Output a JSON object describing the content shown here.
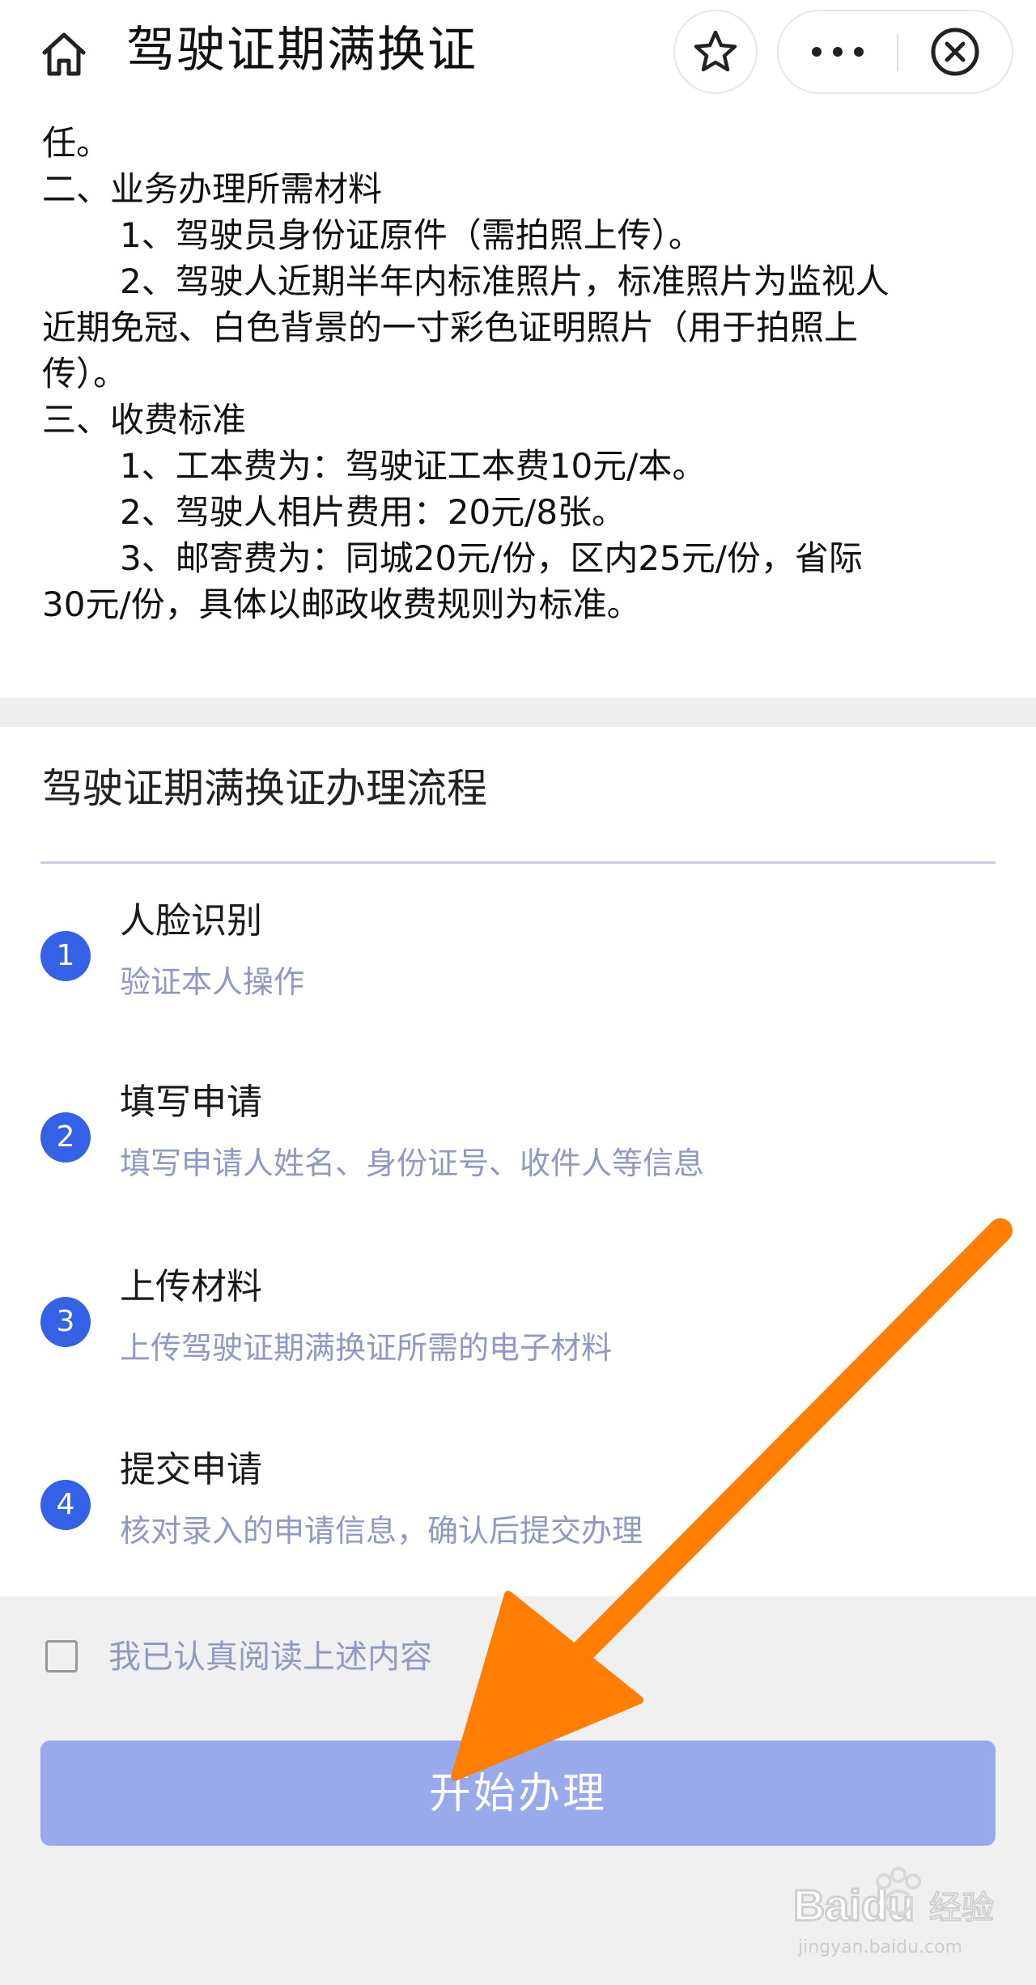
{
  "navbar": {
    "title": "驾驶证期满换证",
    "home_icon": "home-icon",
    "star_icon": "star-icon",
    "more_icon": "more-dots-icon",
    "close_icon": "close-circle-icon"
  },
  "notice": {
    "tail": "任。",
    "section2_title": "二、业务办理所需材料",
    "section2_item1": "1、驾驶员身份证原件（需拍照上传）。",
    "section2_item2_line1": "2、驾驶人近期半年内标准照片，标准照片为监视人",
    "section2_item2_line2": "近期免冠、白色背景的一寸彩色证明照片（用于拍照上",
    "section2_item2_line3": "传）。",
    "section3_title": "三、收费标准",
    "section3_item1": "1、工本费为：驾驶证工本费10元/本。",
    "section3_item2": "2、驾驶人相片费用：20元/8张。",
    "section3_item3_line1": "3、邮寄费为：同城20元/份，区内25元/份，省际",
    "section3_item3_line2": "30元/份，具体以邮政收费规则为标准。"
  },
  "process": {
    "title": "驾驶证期满换证办理流程",
    "steps": [
      {
        "num": "1",
        "title": "人脸识别",
        "desc": "验证本人操作"
      },
      {
        "num": "2",
        "title": "填写申请",
        "desc": "填写申请人姓名、身份证号、收件人等信息"
      },
      {
        "num": "3",
        "title": "上传材料",
        "desc": "上传驾驶证期满换证所需的电子材料"
      },
      {
        "num": "4",
        "title": "提交申请",
        "desc": "核对录入的申请信息，确认后提交办理"
      }
    ]
  },
  "agreement": {
    "label": "我已认真阅读上述内容",
    "checked": false
  },
  "start_button": {
    "label": "开始办理"
  },
  "watermark": {
    "brand": "Baidu",
    "brand_cn": "经验",
    "url": "jingyan.baidu.com"
  },
  "colors": {
    "accent": "#3561e6",
    "button": "#98aaeb",
    "muted_text": "#8f99c1",
    "arrow": "#ff7d00"
  }
}
